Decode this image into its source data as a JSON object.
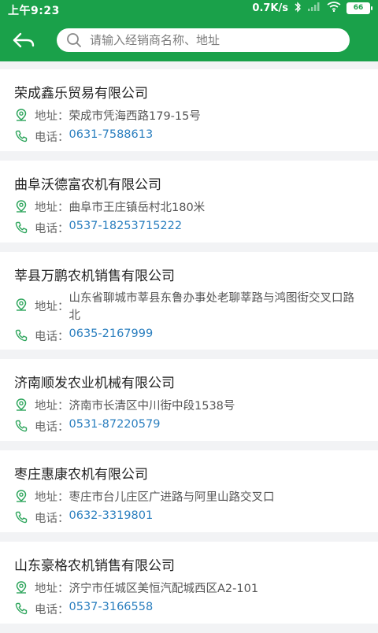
{
  "status": {
    "time": "上午9:23",
    "speed": "0.7K/s",
    "battery": "66"
  },
  "search": {
    "placeholder": "请输入经销商名称、地址"
  },
  "labels": {
    "address": "地址：",
    "phone": "电话："
  },
  "dealers": [
    {
      "name": "荣成鑫乐贸易有限公司",
      "address": "荣成市凭海西路179-15号",
      "phone": "0631-7588613"
    },
    {
      "name": "曲阜沃德富农机有限公司",
      "address": "曲阜市王庄镇岳村北180米",
      "phone": "0537-18253715222"
    },
    {
      "name": "莘县万鹏农机销售有限公司",
      "address": "山东省聊城市莘县东鲁办事处老聊莘路与鸿图街交叉口路北",
      "phone": "0635-2167999"
    },
    {
      "name": "济南顺发农业机械有限公司",
      "address": "济南市长清区中川街中段1538号",
      "phone": "0531-87220579"
    },
    {
      "name": "枣庄惠康农机有限公司",
      "address": "枣庄市台儿庄区广进路与阿里山路交叉口",
      "phone": "0632-3319801"
    },
    {
      "name": "山东豪格农机销售有限公司",
      "address": "济宁市任城区美恒汽配城西区A2-101",
      "phone": "0537-3166558"
    }
  ],
  "colors": {
    "brand_green": "#1aa14a",
    "phone_blue": "#2b7fbf",
    "icon_green": "#2ea55c"
  }
}
